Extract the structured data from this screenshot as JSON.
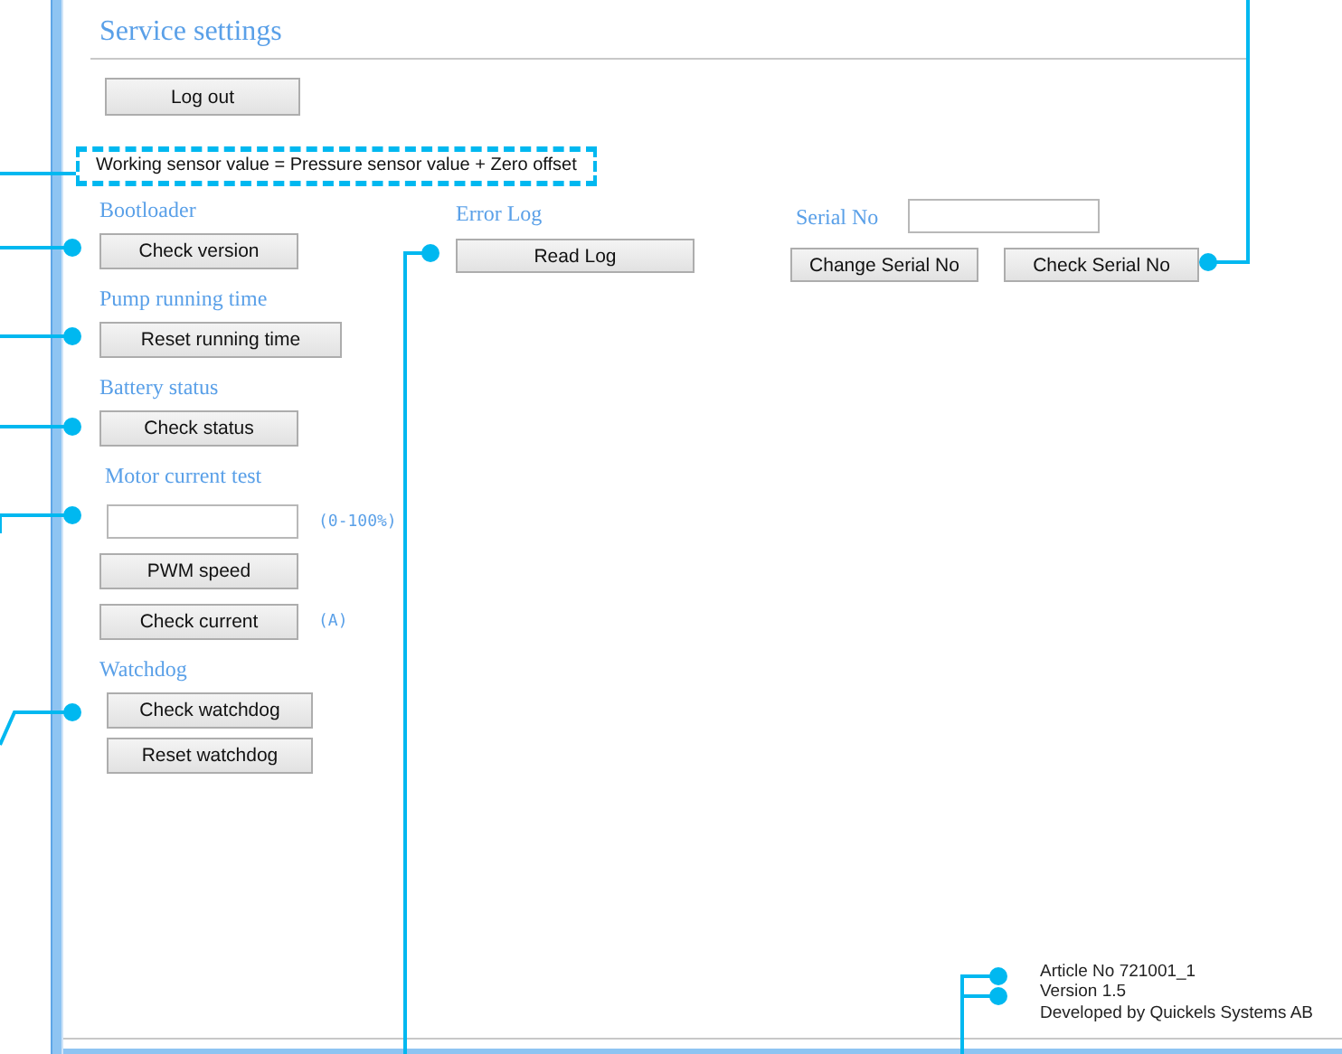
{
  "title": "Service settings",
  "logout_button": "Log out",
  "formula": "Working sensor value = Pressure sensor value + Zero offset",
  "left_sections": [
    {
      "heading": "Bootloader",
      "items": [
        {
          "kind": "button",
          "label": "Check version"
        }
      ]
    },
    {
      "heading": "Pump running time",
      "items": [
        {
          "kind": "button",
          "label": "Reset running time"
        }
      ]
    },
    {
      "heading": "Battery status",
      "items": [
        {
          "kind": "button",
          "label": "Check status"
        }
      ]
    },
    {
      "heading": "Motor current test",
      "items": [
        {
          "kind": "input",
          "unit": "(0-100%)"
        },
        {
          "kind": "button",
          "label": "PWM speed"
        },
        {
          "kind": "button",
          "label": "Check current",
          "unit": "(A)"
        }
      ]
    },
    {
      "heading": "Watchdog",
      "items": [
        {
          "kind": "button",
          "label": "Check watchdog"
        },
        {
          "kind": "button",
          "label": "Reset watchdog"
        }
      ]
    }
  ],
  "error_log": {
    "heading": "Error Log",
    "button": "Read Log"
  },
  "serial": {
    "label": "Serial No",
    "buttons": [
      "Change Serial No",
      "Check Serial No"
    ]
  },
  "footer": [
    "Article No 721001_1",
    "Version 1.5",
    "Developed by Quickels Systems AB"
  ]
}
